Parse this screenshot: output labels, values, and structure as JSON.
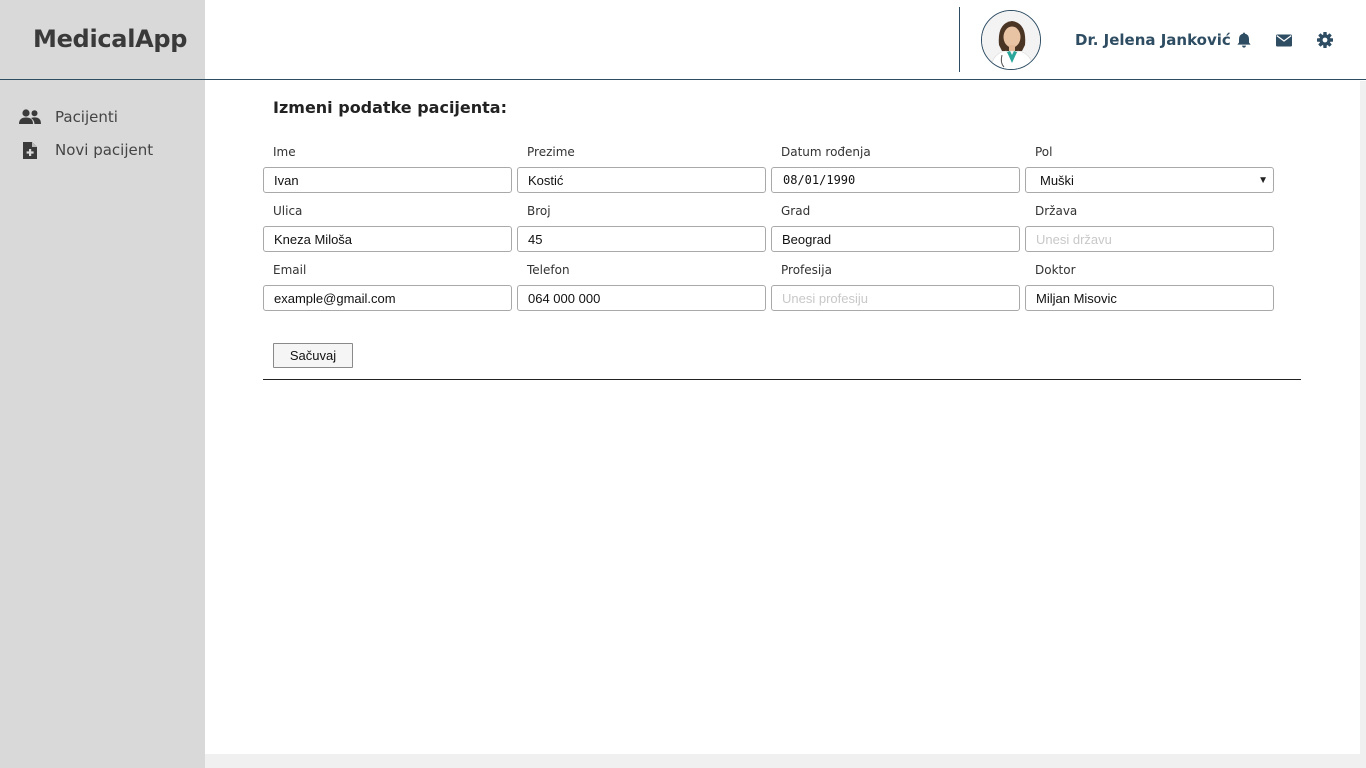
{
  "app": {
    "name": "MedicalApp"
  },
  "sidebar": {
    "items": [
      {
        "label": "Pacijenti",
        "icon": "users-icon"
      },
      {
        "label": "Novi pacijent",
        "icon": "file-medical-icon"
      }
    ]
  },
  "header": {
    "user_name": "Dr. Jelena Janković",
    "icons": [
      "bell-icon",
      "envelope-icon",
      "gear-icon"
    ],
    "accent_color": "#2e4d63"
  },
  "form": {
    "title": "Izmeni podatke pacijenta:",
    "fields": {
      "ime": {
        "label": "Ime",
        "value": "Ivan"
      },
      "prezime": {
        "label": "Prezime",
        "value": "Kostić"
      },
      "datum": {
        "label": "Datum rođenja",
        "value": "08/01/1990"
      },
      "pol": {
        "label": "Pol",
        "value": "Muški"
      },
      "ulica": {
        "label": "Ulica",
        "value": "Kneza Miloša"
      },
      "broj": {
        "label": "Broj",
        "value": "45"
      },
      "grad": {
        "label": "Grad",
        "value": "Beograd"
      },
      "drzava": {
        "label": "Država",
        "value": "",
        "placeholder": "Unesi državu"
      },
      "email": {
        "label": "Email",
        "value": "example@gmail.com"
      },
      "telefon": {
        "label": "Telefon",
        "value": "064 000 000"
      },
      "profesija": {
        "label": "Profesija",
        "value": "",
        "placeholder": "Unesi profesiju"
      },
      "doktor": {
        "label": "Doktor",
        "value": "Miljan Misovic"
      }
    },
    "save_label": "Sačuvaj"
  }
}
